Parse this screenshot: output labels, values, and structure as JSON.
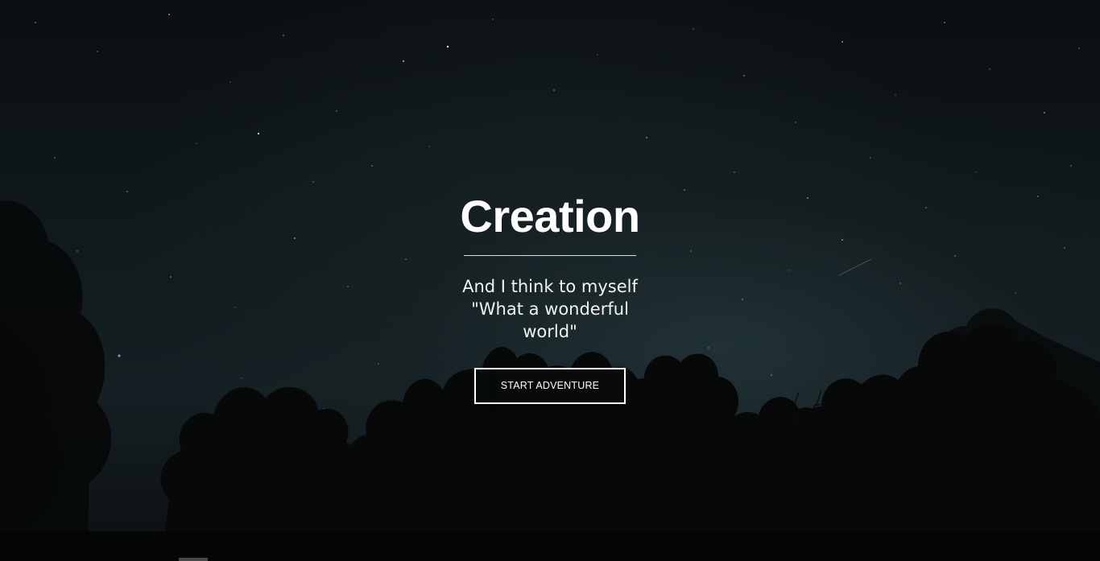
{
  "hero": {
    "title": "Creation",
    "tagline_line1": "And I think to myself",
    "tagline_line2": "\"What a wonderful",
    "tagline_line3": "world\"",
    "cta_label": "START ADVENTURE"
  },
  "colors": {
    "text": "#ffffff",
    "background": "#0b0f11",
    "sky_glow": "#1e2c2e"
  }
}
